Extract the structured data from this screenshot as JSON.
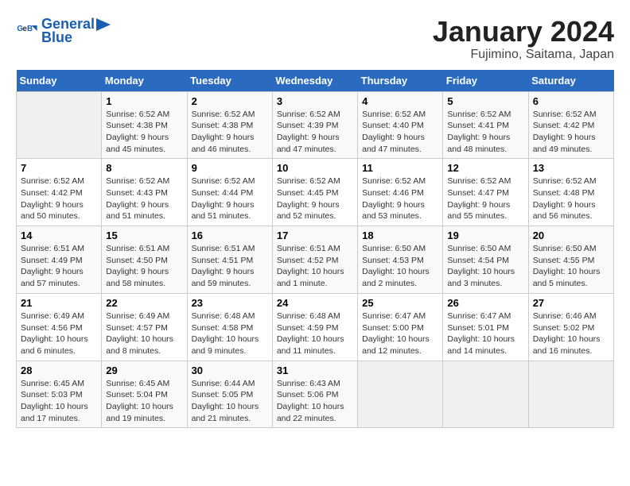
{
  "header": {
    "logo_line1": "General",
    "logo_line2": "Blue",
    "month": "January 2024",
    "location": "Fujimino, Saitama, Japan"
  },
  "days_of_week": [
    "Sunday",
    "Monday",
    "Tuesday",
    "Wednesday",
    "Thursday",
    "Friday",
    "Saturday"
  ],
  "weeks": [
    [
      {
        "day": "",
        "info": ""
      },
      {
        "day": "1",
        "info": "Sunrise: 6:52 AM\nSunset: 4:38 PM\nDaylight: 9 hours\nand 45 minutes."
      },
      {
        "day": "2",
        "info": "Sunrise: 6:52 AM\nSunset: 4:38 PM\nDaylight: 9 hours\nand 46 minutes."
      },
      {
        "day": "3",
        "info": "Sunrise: 6:52 AM\nSunset: 4:39 PM\nDaylight: 9 hours\nand 47 minutes."
      },
      {
        "day": "4",
        "info": "Sunrise: 6:52 AM\nSunset: 4:40 PM\nDaylight: 9 hours\nand 47 minutes."
      },
      {
        "day": "5",
        "info": "Sunrise: 6:52 AM\nSunset: 4:41 PM\nDaylight: 9 hours\nand 48 minutes."
      },
      {
        "day": "6",
        "info": "Sunrise: 6:52 AM\nSunset: 4:42 PM\nDaylight: 9 hours\nand 49 minutes."
      }
    ],
    [
      {
        "day": "7",
        "info": "Sunrise: 6:52 AM\nSunset: 4:42 PM\nDaylight: 9 hours\nand 50 minutes."
      },
      {
        "day": "8",
        "info": "Sunrise: 6:52 AM\nSunset: 4:43 PM\nDaylight: 9 hours\nand 51 minutes."
      },
      {
        "day": "9",
        "info": "Sunrise: 6:52 AM\nSunset: 4:44 PM\nDaylight: 9 hours\nand 51 minutes."
      },
      {
        "day": "10",
        "info": "Sunrise: 6:52 AM\nSunset: 4:45 PM\nDaylight: 9 hours\nand 52 minutes."
      },
      {
        "day": "11",
        "info": "Sunrise: 6:52 AM\nSunset: 4:46 PM\nDaylight: 9 hours\nand 53 minutes."
      },
      {
        "day": "12",
        "info": "Sunrise: 6:52 AM\nSunset: 4:47 PM\nDaylight: 9 hours\nand 55 minutes."
      },
      {
        "day": "13",
        "info": "Sunrise: 6:52 AM\nSunset: 4:48 PM\nDaylight: 9 hours\nand 56 minutes."
      }
    ],
    [
      {
        "day": "14",
        "info": "Sunrise: 6:51 AM\nSunset: 4:49 PM\nDaylight: 9 hours\nand 57 minutes."
      },
      {
        "day": "15",
        "info": "Sunrise: 6:51 AM\nSunset: 4:50 PM\nDaylight: 9 hours\nand 58 minutes."
      },
      {
        "day": "16",
        "info": "Sunrise: 6:51 AM\nSunset: 4:51 PM\nDaylight: 9 hours\nand 59 minutes."
      },
      {
        "day": "17",
        "info": "Sunrise: 6:51 AM\nSunset: 4:52 PM\nDaylight: 10 hours\nand 1 minute."
      },
      {
        "day": "18",
        "info": "Sunrise: 6:50 AM\nSunset: 4:53 PM\nDaylight: 10 hours\nand 2 minutes."
      },
      {
        "day": "19",
        "info": "Sunrise: 6:50 AM\nSunset: 4:54 PM\nDaylight: 10 hours\nand 3 minutes."
      },
      {
        "day": "20",
        "info": "Sunrise: 6:50 AM\nSunset: 4:55 PM\nDaylight: 10 hours\nand 5 minutes."
      }
    ],
    [
      {
        "day": "21",
        "info": "Sunrise: 6:49 AM\nSunset: 4:56 PM\nDaylight: 10 hours\nand 6 minutes."
      },
      {
        "day": "22",
        "info": "Sunrise: 6:49 AM\nSunset: 4:57 PM\nDaylight: 10 hours\nand 8 minutes."
      },
      {
        "day": "23",
        "info": "Sunrise: 6:48 AM\nSunset: 4:58 PM\nDaylight: 10 hours\nand 9 minutes."
      },
      {
        "day": "24",
        "info": "Sunrise: 6:48 AM\nSunset: 4:59 PM\nDaylight: 10 hours\nand 11 minutes."
      },
      {
        "day": "25",
        "info": "Sunrise: 6:47 AM\nSunset: 5:00 PM\nDaylight: 10 hours\nand 12 minutes."
      },
      {
        "day": "26",
        "info": "Sunrise: 6:47 AM\nSunset: 5:01 PM\nDaylight: 10 hours\nand 14 minutes."
      },
      {
        "day": "27",
        "info": "Sunrise: 6:46 AM\nSunset: 5:02 PM\nDaylight: 10 hours\nand 16 minutes."
      }
    ],
    [
      {
        "day": "28",
        "info": "Sunrise: 6:45 AM\nSunset: 5:03 PM\nDaylight: 10 hours\nand 17 minutes."
      },
      {
        "day": "29",
        "info": "Sunrise: 6:45 AM\nSunset: 5:04 PM\nDaylight: 10 hours\nand 19 minutes."
      },
      {
        "day": "30",
        "info": "Sunrise: 6:44 AM\nSunset: 5:05 PM\nDaylight: 10 hours\nand 21 minutes."
      },
      {
        "day": "31",
        "info": "Sunrise: 6:43 AM\nSunset: 5:06 PM\nDaylight: 10 hours\nand 22 minutes."
      },
      {
        "day": "",
        "info": ""
      },
      {
        "day": "",
        "info": ""
      },
      {
        "day": "",
        "info": ""
      }
    ]
  ]
}
